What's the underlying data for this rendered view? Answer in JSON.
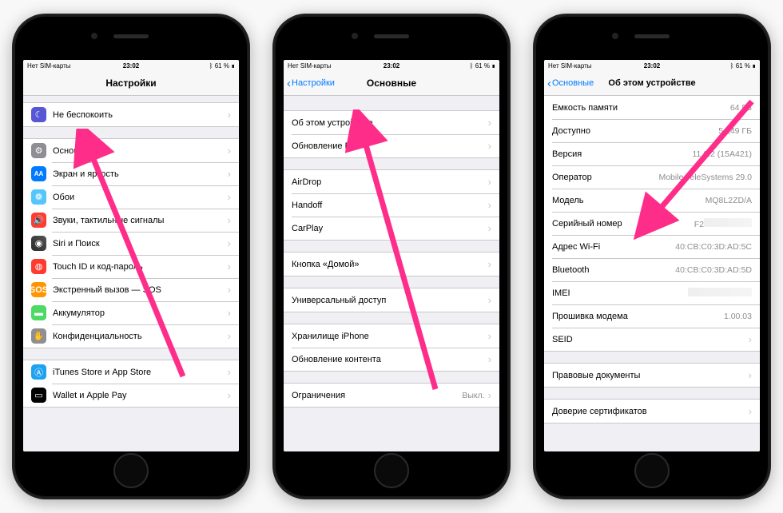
{
  "status": {
    "carrier": "Нет SIM-карты",
    "wifi": "▾",
    "time": "23:02",
    "bt": "⚪︎",
    "battery_pct": "61 %",
    "battery_icon": "■"
  },
  "phone1": {
    "nav_title": "Настройки",
    "rows": {
      "dnd": "Не беспокоить",
      "general": "Основные",
      "display": "Экран и яркость",
      "wallpaper": "Обои",
      "sounds": "Звуки, тактильные сигналы",
      "siri": "Siri и Поиск",
      "touchid": "Touch ID и код-пароль",
      "sos": "Экстренный вызов — SOS",
      "battery": "Аккумулятор",
      "privacy": "Конфиденциальность",
      "itunes": "iTunes Store и App Store",
      "wallet": "Wallet и Apple Pay"
    }
  },
  "phone2": {
    "nav_back": "Настройки",
    "nav_title": "Основные",
    "rows": {
      "about": "Об этом устройстве",
      "update": "Обновление ПО",
      "airdrop": "AirDrop",
      "handoff": "Handoff",
      "carplay": "CarPlay",
      "home": "Кнопка «Домой»",
      "accessibility": "Универсальный доступ",
      "storage": "Хранилище iPhone",
      "content_update": "Обновление контента",
      "restrictions": "Ограничения",
      "restrictions_value": "Выкл."
    }
  },
  "phone3": {
    "nav_back": "Основные",
    "nav_title": "Об этом устройстве",
    "rows": {
      "capacity_label": "Емкость памяти",
      "capacity_value": "64 ГБ",
      "available_label": "Доступно",
      "available_value": "54,49 ГБ",
      "version_label": "Версия",
      "version_value": "11.0.2 (15A421)",
      "carrier_label": "Оператор",
      "carrier_value": "Mobile TeleSystems 29.0",
      "model_label": "Модель",
      "model_value": "MQ8L2ZD/A",
      "serial_label": "Серийный номер",
      "serial_value": "F2",
      "wifi_label": "Адрес Wi-Fi",
      "wifi_value": "40:CB:C0:3D:AD:5C",
      "bt_label": "Bluetooth",
      "bt_value": "40:CB:C0:3D:AD:5D",
      "imei_label": "IMEI",
      "modem_label": "Прошивка модема",
      "modem_value": "1.00.03",
      "seid_label": "SEID",
      "legal_label": "Правовые документы",
      "trust_label": "Доверие сертификатов"
    }
  }
}
